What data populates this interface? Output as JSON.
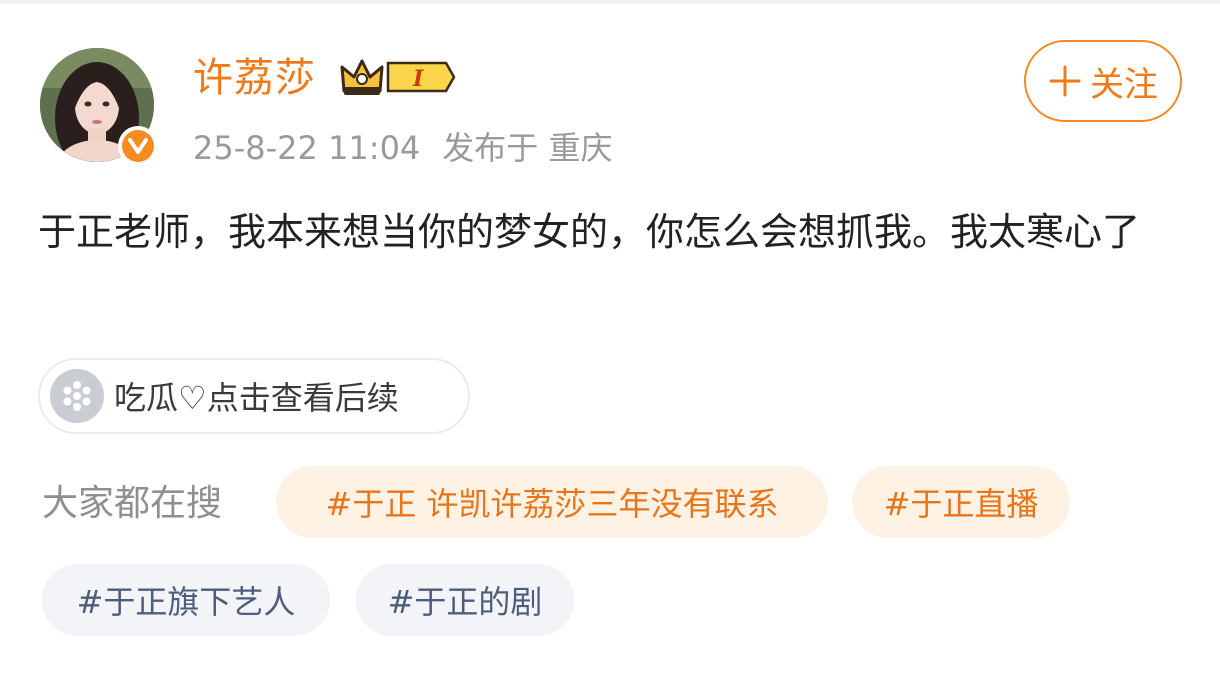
{
  "post": {
    "author": "许荔莎",
    "badge_level": "I",
    "meta": {
      "time": "25-8-22 11:04",
      "location": "发布于 重庆"
    },
    "follow_label": "关注",
    "content": "于正老师，我本来想当你的梦女的，你怎么会想抓我。我太寒心了",
    "attachment_label": "吃瓜♡点击查看后续"
  },
  "search": {
    "label": "大家都在搜",
    "tags": [
      {
        "text": "#于正 许凯许荔莎三年没有联系",
        "hot": true
      },
      {
        "text": "#于正直播",
        "hot": true
      },
      {
        "text": "#于正旗下艺人",
        "hot": false
      },
      {
        "text": "#于正的剧",
        "hot": false
      }
    ]
  },
  "colors": {
    "accent": "#ee7a1b",
    "verified": "#f68b1f",
    "tag_hot_bg": "#fdf2e4",
    "tag_norm_bg": "#f3f4f8"
  },
  "icons": {
    "verified": "verified-v-icon",
    "crown": "crown-icon",
    "follow": "plus-icon",
    "attachment": "melon-icon"
  }
}
